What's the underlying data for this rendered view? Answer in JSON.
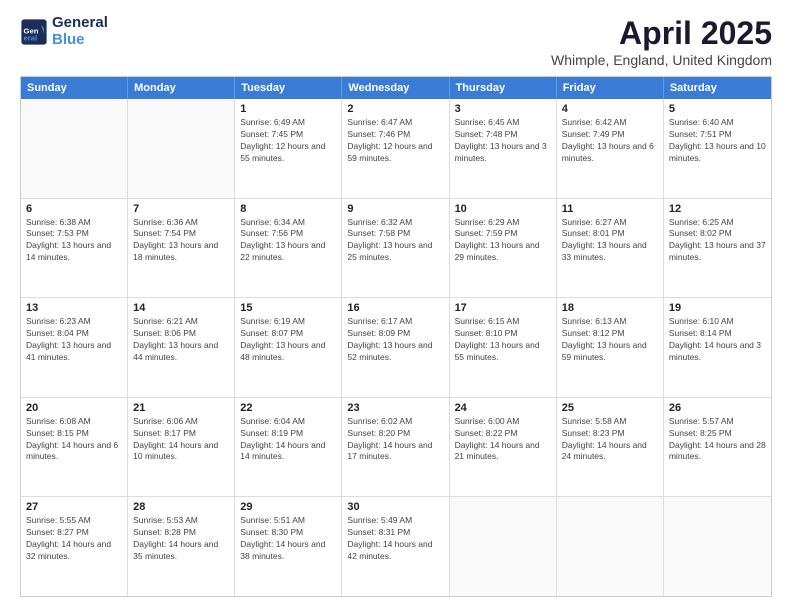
{
  "logo": {
    "line1": "General",
    "line2": "Blue"
  },
  "title": "April 2025",
  "subtitle": "Whimple, England, United Kingdom",
  "days": [
    "Sunday",
    "Monday",
    "Tuesday",
    "Wednesday",
    "Thursday",
    "Friday",
    "Saturday"
  ],
  "weeks": [
    [
      {
        "day": null,
        "info": null
      },
      {
        "day": null,
        "info": null
      },
      {
        "day": "1",
        "info": "Sunrise: 6:49 AM\nSunset: 7:45 PM\nDaylight: 12 hours and 55 minutes."
      },
      {
        "day": "2",
        "info": "Sunrise: 6:47 AM\nSunset: 7:46 PM\nDaylight: 12 hours and 59 minutes."
      },
      {
        "day": "3",
        "info": "Sunrise: 6:45 AM\nSunset: 7:48 PM\nDaylight: 13 hours and 3 minutes."
      },
      {
        "day": "4",
        "info": "Sunrise: 6:42 AM\nSunset: 7:49 PM\nDaylight: 13 hours and 6 minutes."
      },
      {
        "day": "5",
        "info": "Sunrise: 6:40 AM\nSunset: 7:51 PM\nDaylight: 13 hours and 10 minutes."
      }
    ],
    [
      {
        "day": "6",
        "info": "Sunrise: 6:38 AM\nSunset: 7:53 PM\nDaylight: 13 hours and 14 minutes."
      },
      {
        "day": "7",
        "info": "Sunrise: 6:36 AM\nSunset: 7:54 PM\nDaylight: 13 hours and 18 minutes."
      },
      {
        "day": "8",
        "info": "Sunrise: 6:34 AM\nSunset: 7:56 PM\nDaylight: 13 hours and 22 minutes."
      },
      {
        "day": "9",
        "info": "Sunrise: 6:32 AM\nSunset: 7:58 PM\nDaylight: 13 hours and 25 minutes."
      },
      {
        "day": "10",
        "info": "Sunrise: 6:29 AM\nSunset: 7:59 PM\nDaylight: 13 hours and 29 minutes."
      },
      {
        "day": "11",
        "info": "Sunrise: 6:27 AM\nSunset: 8:01 PM\nDaylight: 13 hours and 33 minutes."
      },
      {
        "day": "12",
        "info": "Sunrise: 6:25 AM\nSunset: 8:02 PM\nDaylight: 13 hours and 37 minutes."
      }
    ],
    [
      {
        "day": "13",
        "info": "Sunrise: 6:23 AM\nSunset: 8:04 PM\nDaylight: 13 hours and 41 minutes."
      },
      {
        "day": "14",
        "info": "Sunrise: 6:21 AM\nSunset: 8:06 PM\nDaylight: 13 hours and 44 minutes."
      },
      {
        "day": "15",
        "info": "Sunrise: 6:19 AM\nSunset: 8:07 PM\nDaylight: 13 hours and 48 minutes."
      },
      {
        "day": "16",
        "info": "Sunrise: 6:17 AM\nSunset: 8:09 PM\nDaylight: 13 hours and 52 minutes."
      },
      {
        "day": "17",
        "info": "Sunrise: 6:15 AM\nSunset: 8:10 PM\nDaylight: 13 hours and 55 minutes."
      },
      {
        "day": "18",
        "info": "Sunrise: 6:13 AM\nSunset: 8:12 PM\nDaylight: 13 hours and 59 minutes."
      },
      {
        "day": "19",
        "info": "Sunrise: 6:10 AM\nSunset: 8:14 PM\nDaylight: 14 hours and 3 minutes."
      }
    ],
    [
      {
        "day": "20",
        "info": "Sunrise: 6:08 AM\nSunset: 8:15 PM\nDaylight: 14 hours and 6 minutes."
      },
      {
        "day": "21",
        "info": "Sunrise: 6:06 AM\nSunset: 8:17 PM\nDaylight: 14 hours and 10 minutes."
      },
      {
        "day": "22",
        "info": "Sunrise: 6:04 AM\nSunset: 8:19 PM\nDaylight: 14 hours and 14 minutes."
      },
      {
        "day": "23",
        "info": "Sunrise: 6:02 AM\nSunset: 8:20 PM\nDaylight: 14 hours and 17 minutes."
      },
      {
        "day": "24",
        "info": "Sunrise: 6:00 AM\nSunset: 8:22 PM\nDaylight: 14 hours and 21 minutes."
      },
      {
        "day": "25",
        "info": "Sunrise: 5:58 AM\nSunset: 8:23 PM\nDaylight: 14 hours and 24 minutes."
      },
      {
        "day": "26",
        "info": "Sunrise: 5:57 AM\nSunset: 8:25 PM\nDaylight: 14 hours and 28 minutes."
      }
    ],
    [
      {
        "day": "27",
        "info": "Sunrise: 5:55 AM\nSunset: 8:27 PM\nDaylight: 14 hours and 32 minutes."
      },
      {
        "day": "28",
        "info": "Sunrise: 5:53 AM\nSunset: 8:28 PM\nDaylight: 14 hours and 35 minutes."
      },
      {
        "day": "29",
        "info": "Sunrise: 5:51 AM\nSunset: 8:30 PM\nDaylight: 14 hours and 38 minutes."
      },
      {
        "day": "30",
        "info": "Sunrise: 5:49 AM\nSunset: 8:31 PM\nDaylight: 14 hours and 42 minutes."
      },
      {
        "day": null,
        "info": null
      },
      {
        "day": null,
        "info": null
      },
      {
        "day": null,
        "info": null
      }
    ]
  ]
}
